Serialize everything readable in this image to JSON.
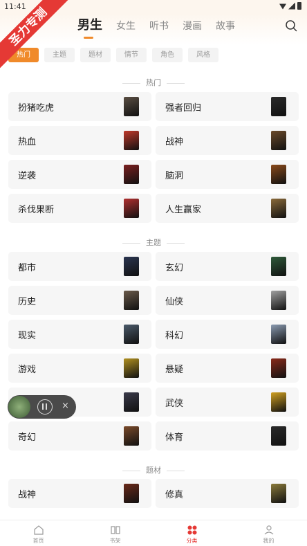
{
  "status": {
    "time": "11:41"
  },
  "badge": "圣力专测",
  "tabs": [
    {
      "label": "男生",
      "active": true
    },
    {
      "label": "女生"
    },
    {
      "label": "听书"
    },
    {
      "label": "漫画"
    },
    {
      "label": "故事"
    }
  ],
  "chips": [
    {
      "label": "热门",
      "active": true
    },
    {
      "label": "主题"
    },
    {
      "label": "题材"
    },
    {
      "label": "情节"
    },
    {
      "label": "角色"
    },
    {
      "label": "风格"
    }
  ],
  "sections": [
    {
      "title": "热门",
      "items": [
        {
          "label": "扮猪吃虎",
          "color": "#5a4e43"
        },
        {
          "label": "强者回归",
          "color": "#2b2b2b"
        },
        {
          "label": "热血",
          "color": "#c0392b"
        },
        {
          "label": "战神",
          "color": "#6b4a2a"
        },
        {
          "label": "逆袭",
          "color": "#7a1f1f"
        },
        {
          "label": "脑洞",
          "color": "#8a4a1a"
        },
        {
          "label": "杀伐果断",
          "color": "#b03030"
        },
        {
          "label": "人生赢家",
          "color": "#8a6a3a"
        }
      ]
    },
    {
      "title": "主题",
      "items": [
        {
          "label": "都市",
          "color": "#2a3550"
        },
        {
          "label": "玄幻",
          "color": "#2f5a3a"
        },
        {
          "label": "历史",
          "color": "#6a5a4a"
        },
        {
          "label": "仙侠",
          "color": "#a0a0a0"
        },
        {
          "label": "现实",
          "color": "#4a5a6a"
        },
        {
          "label": "科幻",
          "color": "#8a9ab0"
        },
        {
          "label": "游戏",
          "color": "#b09020"
        },
        {
          "label": "悬疑",
          "color": "#8a2a1a"
        },
        {
          "label": "",
          "color": "#3a3a4a"
        },
        {
          "label": "武侠",
          "color": "#d0a020"
        },
        {
          "label": "奇幻",
          "color": "#7a4a2a"
        },
        {
          "label": "体育",
          "color": "#2a2a2a"
        }
      ]
    },
    {
      "title": "题材",
      "items": [
        {
          "label": "战神",
          "color": "#6a2a1a"
        },
        {
          "label": "修真",
          "color": "#8a7a3a"
        }
      ]
    }
  ],
  "player": {
    "close": "×"
  },
  "nav": [
    {
      "label": "首页",
      "icon": "home-icon"
    },
    {
      "label": "书架",
      "icon": "bookshelf-icon"
    },
    {
      "label": "分类",
      "icon": "category-icon",
      "active": true
    },
    {
      "label": "我的",
      "icon": "profile-icon"
    }
  ]
}
